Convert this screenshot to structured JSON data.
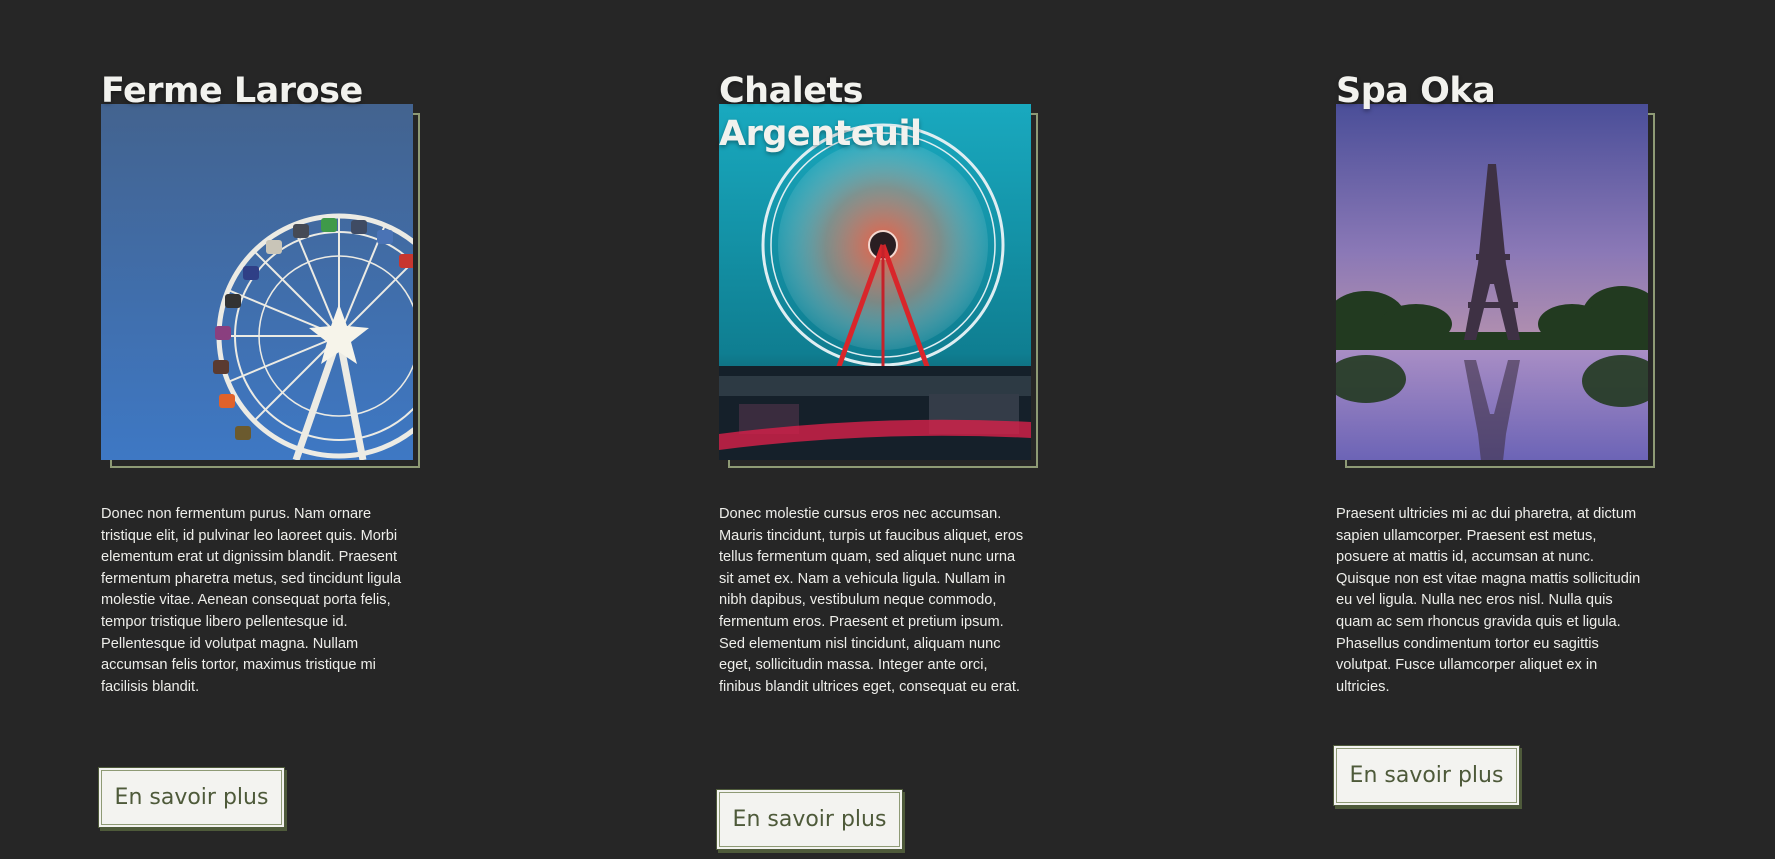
{
  "cards": [
    {
      "title": "Ferme Larose",
      "description": "Donec non fermentum purus. Nam ornare tristique elit, id pulvinar leo laoreet quis. Morbi elementum erat ut dignissim blandit. Praesent fermentum pharetra metus, sed tincidunt ligula molestie vitae. Aenean consequat porta felis, tempor tristique libero pellentesque id. Pellentesque id volutpat magna. Nullam accumsan felis tortor, maximus tristique mi facilisis blandit.",
      "button_label": "En savoir plus",
      "image_icon": "ferris-wheel-photo"
    },
    {
      "title": "Chalets Argenteuil",
      "description": "Donec molestie cursus eros nec accumsan. Mauris tincidunt, turpis ut faucibus aliquet, eros tellus fermentum quam, sed aliquet nunc urna sit amet ex. Nam a vehicula ligula. Nullam in nibh dapibus, vestibulum neque commodo, fermentum eros. Praesent et pretium ipsum. Sed elementum nisl tincidunt, aliquam nunc eget, sollicitudin massa. Integer ante orci, finibus blandit ultrices eget, consequat eu erat.",
      "button_label": "En savoir plus",
      "image_icon": "spinning-ferris-wheel-photo"
    },
    {
      "title": "Spa Oka",
      "description": "Praesent ultricies mi ac dui pharetra, at dictum sapien ullamcorper. Praesent est metus, posuere at mattis id, accumsan at nunc. Quisque non est vitae magna mattis sollicitudin eu vel ligula. Nulla nec eros nisl. Nulla quis quam ac sem rhoncus gravida quis et ligula. Phasellus condimentum tortor eu sagittis volutpat. Fusce ullamcorper aliquet ex in ultricies.",
      "button_label": "En savoir plus",
      "image_icon": "eiffel-tower-photo"
    }
  ],
  "colors": {
    "background": "#262626",
    "accent": "#8e9a75",
    "button_text": "#4e5a3a",
    "button_bg": "#f3f3f0",
    "text": "#eeeeea"
  }
}
